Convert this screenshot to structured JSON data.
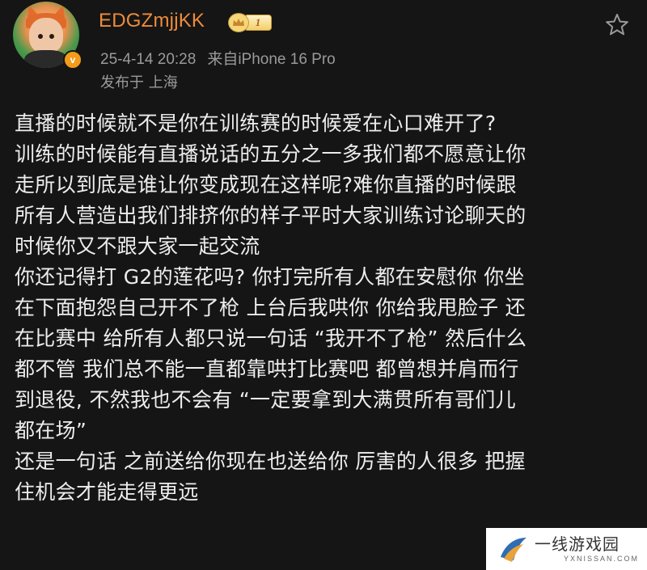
{
  "post": {
    "author": {
      "username": "EDGZmjjKK",
      "level_badge": "1",
      "verified_mark": "v",
      "avatar_icon": "avatar-image"
    },
    "timestamp": "25-4-14 20:28",
    "source": "来自iPhone 16 Pro",
    "location": "发布于 上海",
    "lines": [
      "直播的时候就不是你在训练赛的时候爱在心口难开了?",
      "训练的时候能有直播说话的五分之一多我们都不愿意让你",
      "走所以到底是谁让你变成现在这样呢?难你直播的时候跟",
      "所有人营造出我们排挤你的样子平时大家训练讨论聊天的",
      "时候你又不跟大家一起交流",
      "你还记得打 G2的莲花吗? 你打完所有人都在安慰你 你坐",
      "在下面抱怨自己开不了枪 上台后我哄你 你给我甩脸子 还",
      "在比赛中 给所有人都只说一句话 “我开不了枪” 然后什么",
      "都不管 我们总不能一直都靠哄打比赛吧 都曾想并肩而行",
      "到退役, 不然我也不会有 “一定要拿到大满贯所有哥们儿",
      "都在场”",
      "还是一句话 之前送给你现在也送给你 厉害的人很多 把握",
      "住机会才能走得更远"
    ]
  },
  "icons": {
    "favorite": "star-outline-icon",
    "badge_crown": "crown-icon"
  },
  "watermark": {
    "title": "一线游戏园",
    "url": "YXNISSAN.COM"
  },
  "colors": {
    "background": "#151515",
    "username": "#ee8c3c",
    "meta": "#9a9a9a",
    "body_text": "#ededed",
    "verified": "#f39b1a"
  }
}
